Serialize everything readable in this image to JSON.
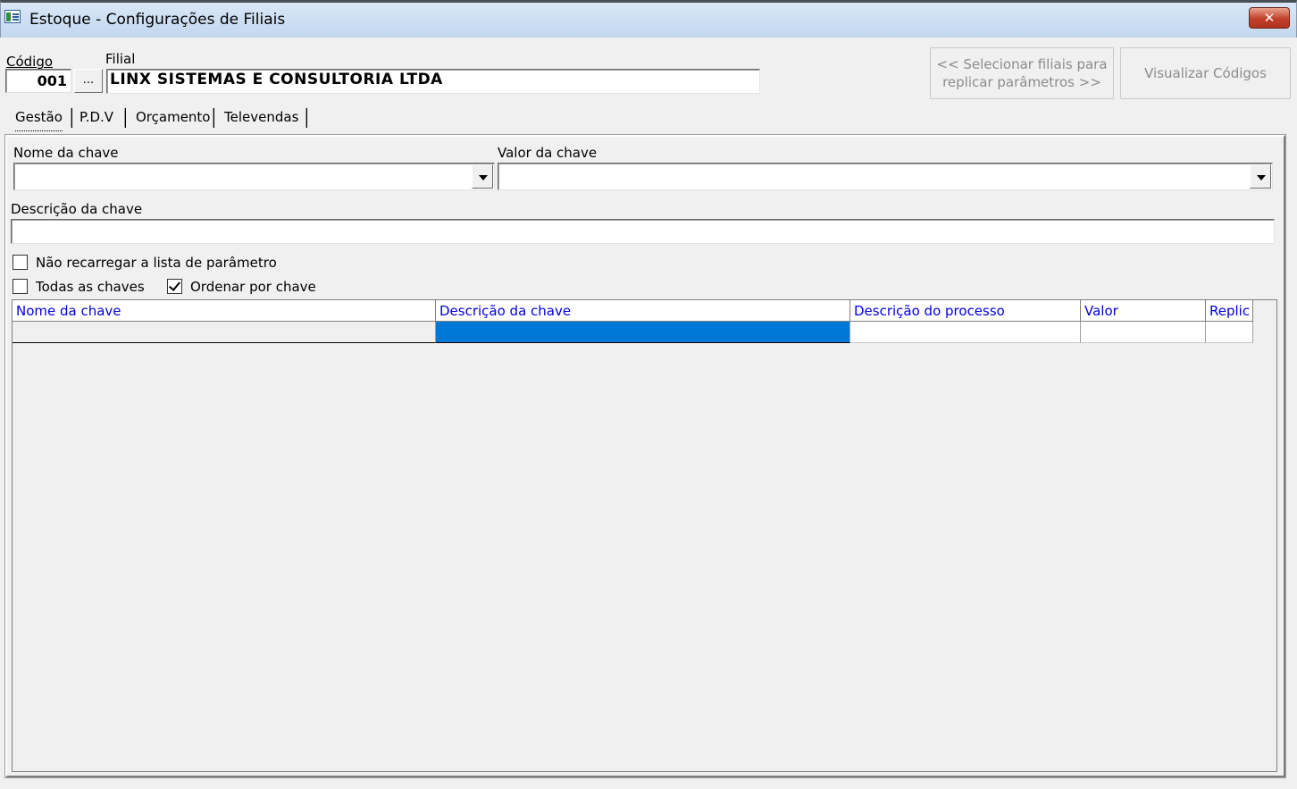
{
  "window": {
    "title": "Estoque - Configurações de Filiais",
    "close_glyph": "✕"
  },
  "header": {
    "codigo_label": "Código",
    "codigo_value": "001",
    "lookup_label": "...",
    "filial_label": "Filial",
    "filial_value": "LINX SISTEMAS E CONSULTORIA LTDA"
  },
  "buttons": {
    "select_filiais_line1": "<< Selecionar filiais para",
    "select_filiais_line2": "replicar parâmetros >>",
    "view_codes": "Visualizar Códigos"
  },
  "tabs": [
    {
      "label": "Gestão",
      "active": true
    },
    {
      "label": "P.D.V",
      "active": false
    },
    {
      "label": "Orçamento",
      "active": false
    },
    {
      "label": "Televendas",
      "active": false
    }
  ],
  "filters": {
    "nome_chave_label": "Nome da chave",
    "nome_chave_value": "",
    "valor_chave_label": "Valor da chave",
    "valor_chave_value": "",
    "descricao_chave_label": "Descrição da chave",
    "descricao_chave_value": ""
  },
  "options": {
    "nao_recarregar": {
      "label": "Não recarregar a lista de parâmetro",
      "checked": false
    },
    "todas_chaves": {
      "label": "Todas as chaves",
      "checked": false
    },
    "ordenar_chave": {
      "label": "Ordenar por chave",
      "checked": true
    }
  },
  "grid": {
    "columns": [
      "Nome da chave",
      "Descrição  da chave",
      "Descrição do processo",
      "Valor",
      "Replic"
    ],
    "rows": [
      [
        "",
        "",
        "",
        "",
        ""
      ]
    ],
    "header_color": "#0000e0",
    "selection_color": "#0078d7"
  }
}
